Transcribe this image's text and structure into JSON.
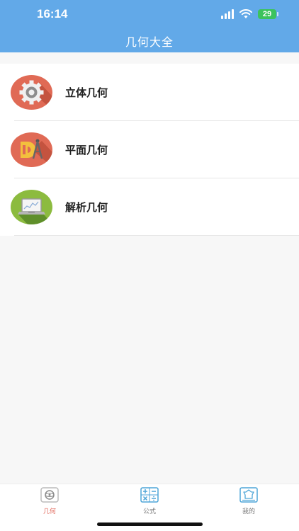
{
  "status": {
    "time": "16:14",
    "battery": "29"
  },
  "nav": {
    "title": "几何大全"
  },
  "items": [
    {
      "label": "立体几何",
      "icon": "gear-icon",
      "color": "#e06a55"
    },
    {
      "label": "平面几何",
      "icon": "ruler-compass-icon",
      "color": "#e06a55"
    },
    {
      "label": "解析几何",
      "icon": "laptop-chart-icon",
      "color": "#8cbb3f"
    }
  ],
  "tabs": [
    {
      "label": "几何",
      "icon": "geometry-icon",
      "active": true
    },
    {
      "label": "公式",
      "icon": "calculator-icon",
      "active": false
    },
    {
      "label": "我的",
      "icon": "profile-icon",
      "active": false
    }
  ],
  "colors": {
    "header": "#62a9e8",
    "accent": "#e0675a"
  }
}
